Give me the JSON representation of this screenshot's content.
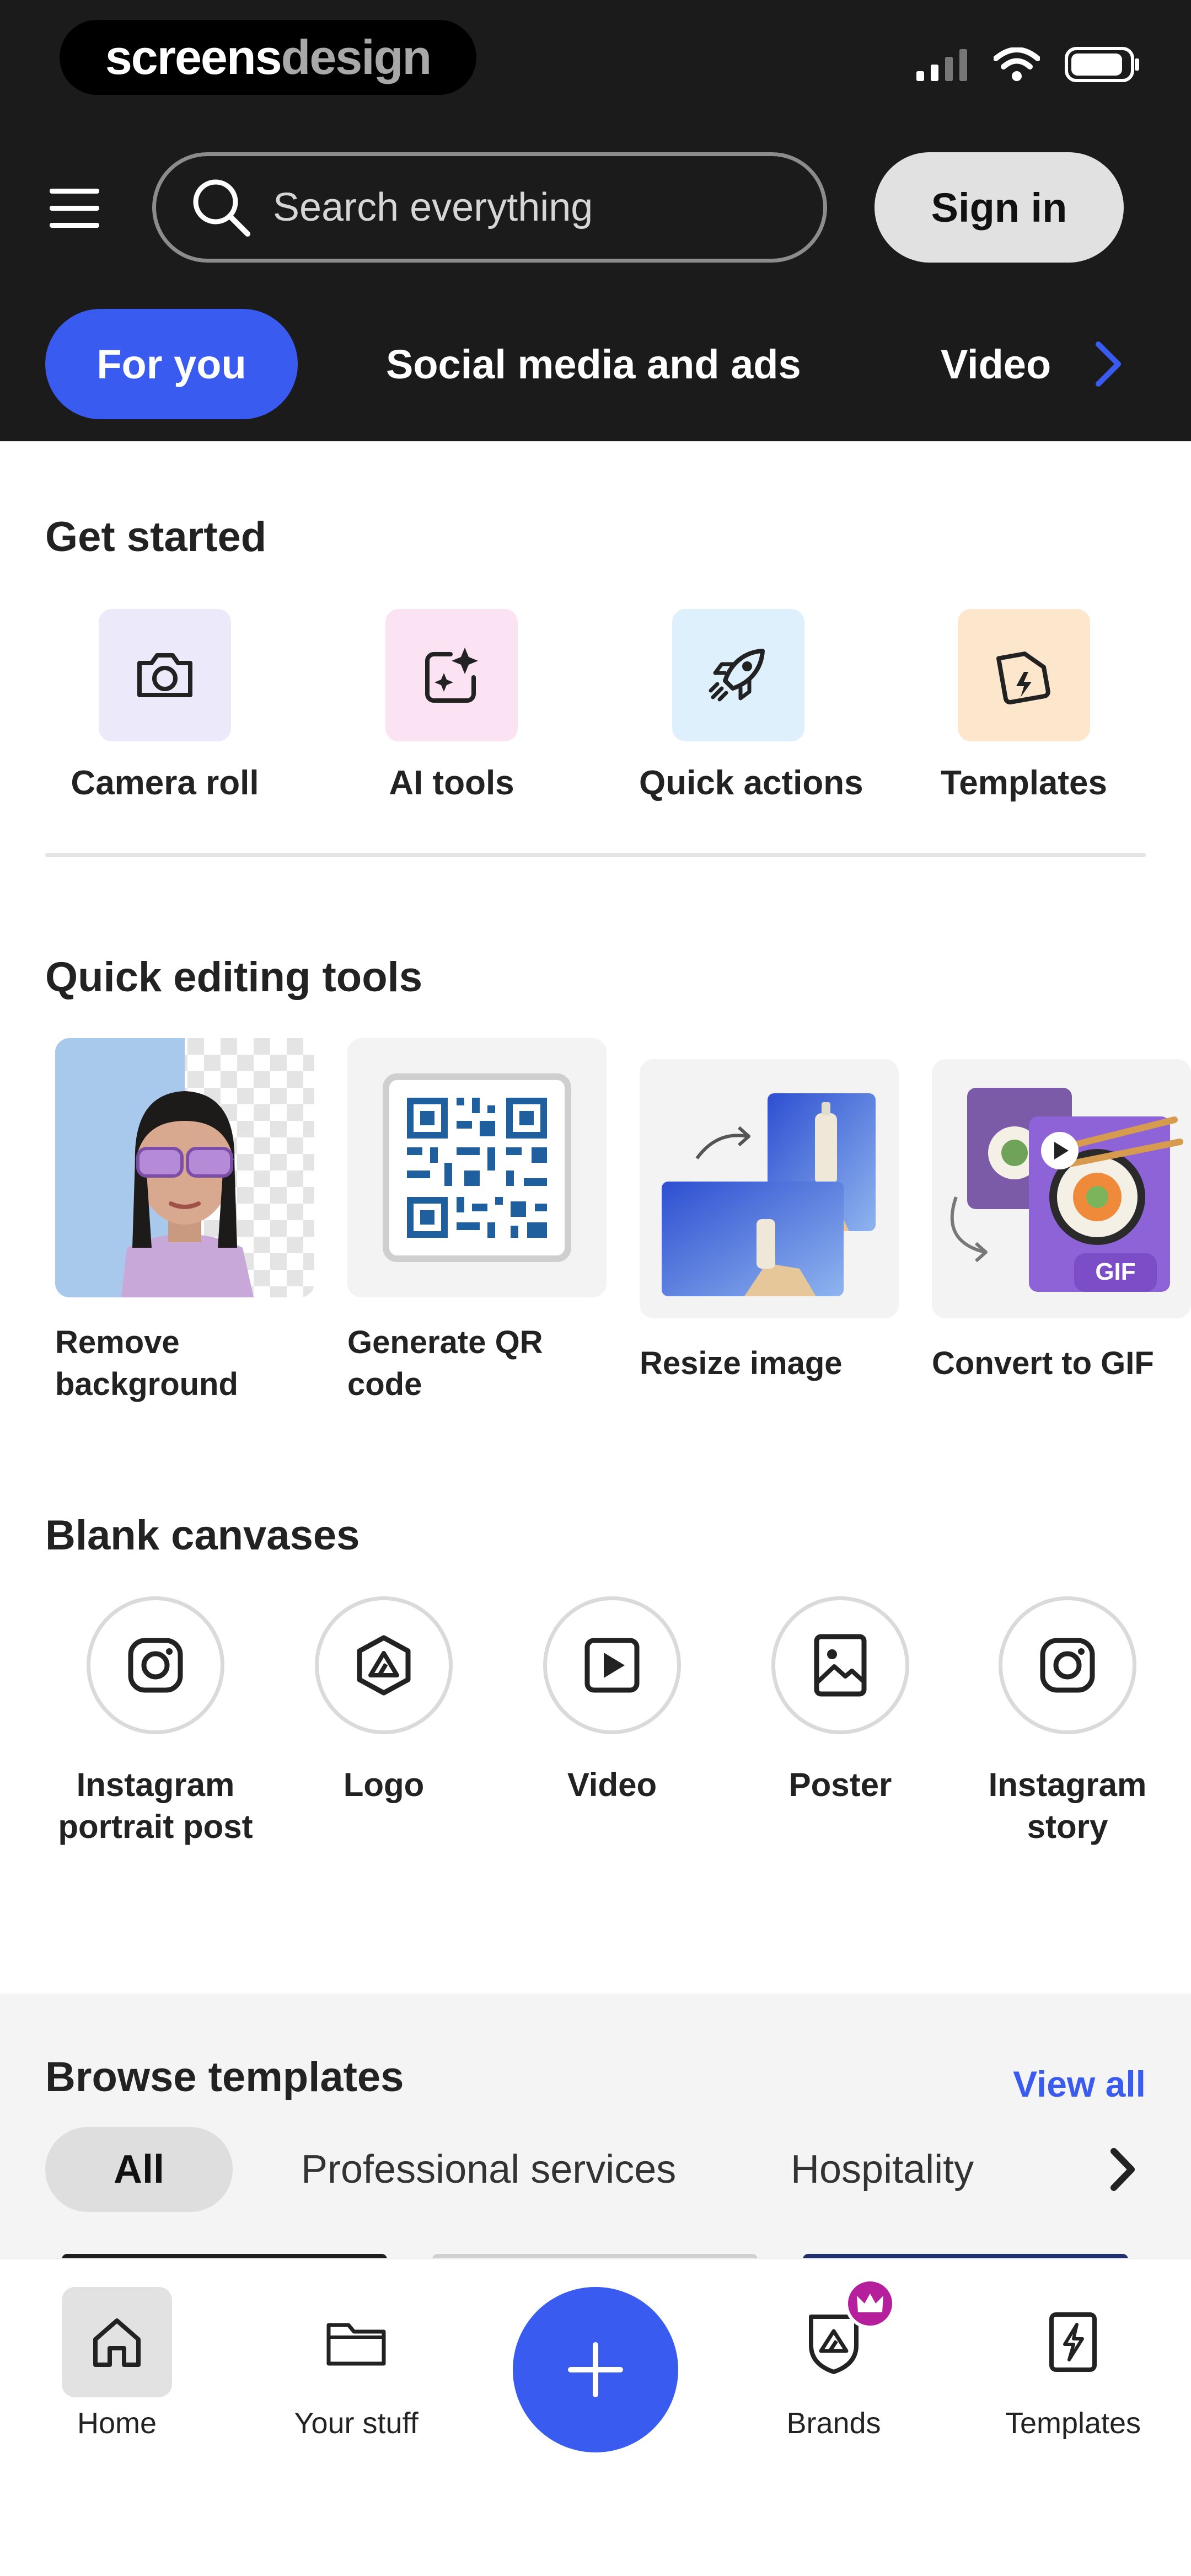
{
  "watermark": {
    "part_a": "screens",
    "part_b": "design"
  },
  "header": {
    "search_placeholder": "Search everything",
    "sign_in_label": "Sign in",
    "categories": [
      "For you",
      "Social media and ads",
      "Video"
    ]
  },
  "get_started": {
    "title": "Get started",
    "items": [
      {
        "label": "Camera roll",
        "icon": "camera-icon",
        "tile_color": "#ece9fb"
      },
      {
        "label": "AI tools",
        "icon": "ai-sparkle-icon",
        "tile_color": "#fbe3f4"
      },
      {
        "label": "Quick actions",
        "icon": "rocket-icon",
        "tile_color": "#dff0fd"
      },
      {
        "label": "Templates",
        "icon": "templates-icon",
        "tile_color": "#fde7cc"
      }
    ]
  },
  "quick_editing": {
    "title": "Quick editing tools",
    "items": [
      {
        "label": "Remove background"
      },
      {
        "label": "Generate QR code"
      },
      {
        "label": "Resize image"
      },
      {
        "label": "Convert to GIF",
        "badge": "GIF"
      }
    ]
  },
  "blank_canvases": {
    "title": "Blank canvases",
    "items": [
      {
        "label": "Instagram portrait post",
        "icon": "instagram-icon"
      },
      {
        "label": "Logo",
        "icon": "logo-icon"
      },
      {
        "label": "Video",
        "icon": "video-icon"
      },
      {
        "label": "Poster",
        "icon": "poster-icon"
      },
      {
        "label": "Instagram story",
        "icon": "instagram-icon"
      }
    ]
  },
  "browse_templates": {
    "title": "Browse templates",
    "view_all_label": "View all",
    "filters": [
      "All",
      "Professional services",
      "Hospitality"
    ]
  },
  "bottom_nav": {
    "items": [
      {
        "label": "Home",
        "icon": "home-icon",
        "active": true
      },
      {
        "label": "Your stuff",
        "icon": "folder-icon"
      },
      {
        "label": "Brands",
        "icon": "brands-icon"
      },
      {
        "label": "Templates",
        "icon": "templates-icon"
      }
    ],
    "create_icon": "plus-icon"
  },
  "colors": {
    "accent": "#3a5bf0",
    "header_bg": "#1b1b1b",
    "brand_badge": "#b51f9c"
  }
}
